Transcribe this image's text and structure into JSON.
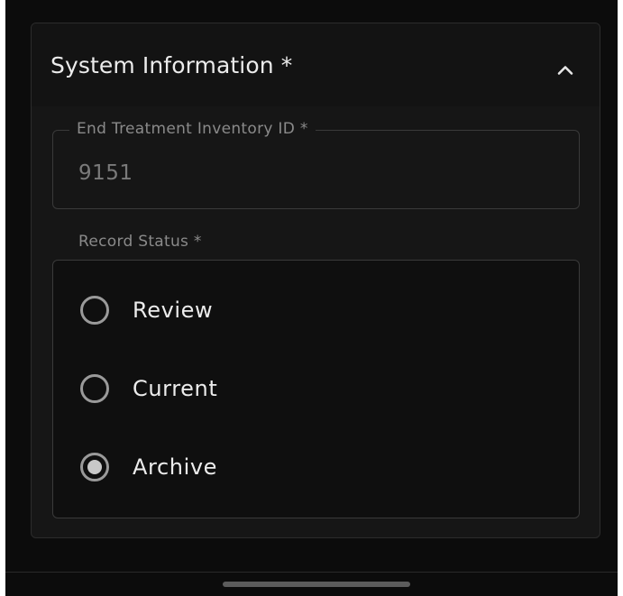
{
  "section": {
    "title": "System Information *",
    "collapse_icon": "chevron-up-icon",
    "expanded": true
  },
  "inventory_field": {
    "label": "End Treatment Inventory ID *",
    "value": "9151"
  },
  "record_status": {
    "label": "Record Status *",
    "options": [
      {
        "label": "Review",
        "selected": false
      },
      {
        "label": "Current",
        "selected": false
      },
      {
        "label": "Archive",
        "selected": true
      }
    ]
  },
  "colors": {
    "background": "#0c0c0c",
    "card": "#161616",
    "text": "#ececec",
    "muted": "#8a8a8a"
  }
}
